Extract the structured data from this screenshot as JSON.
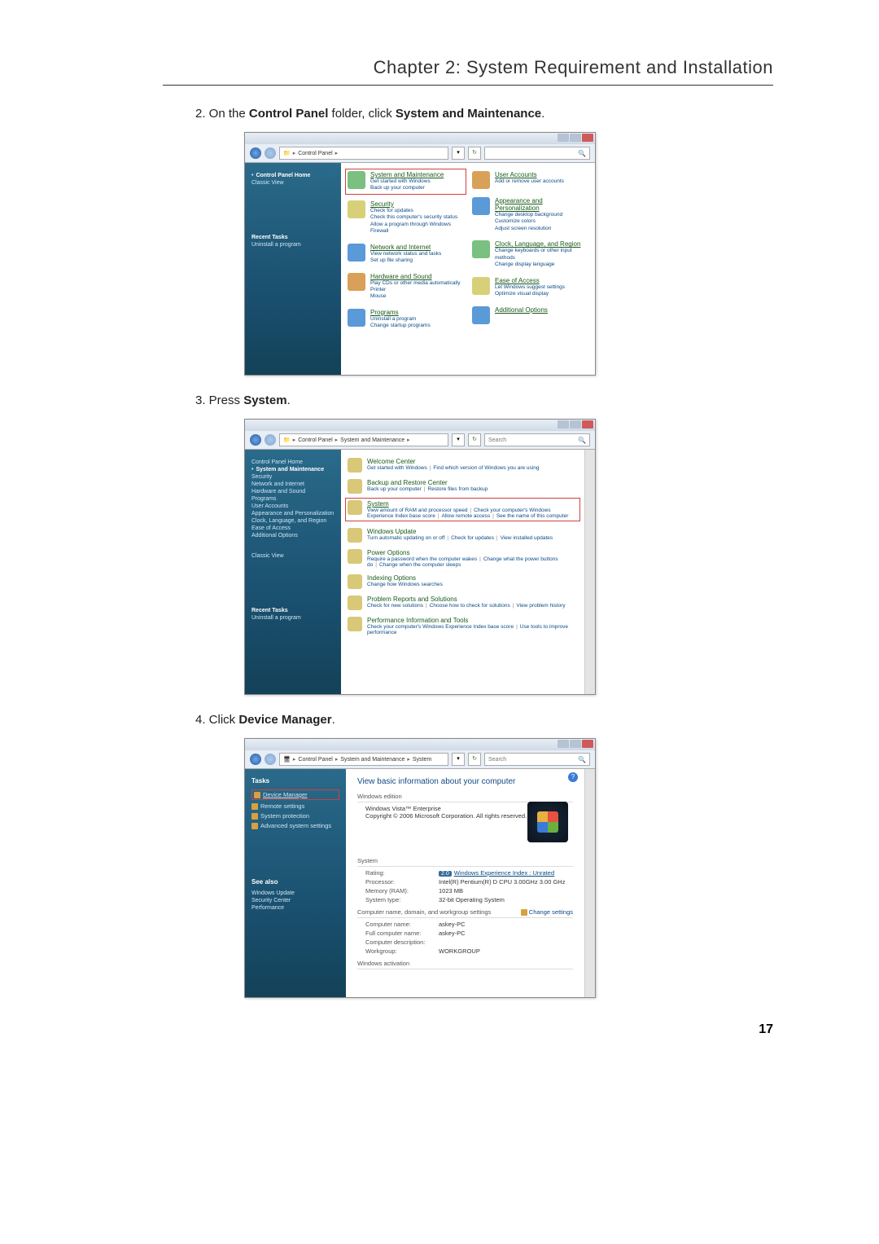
{
  "header": {
    "chapter_title": "Chapter 2: System Requirement and Installation"
  },
  "steps": {
    "s2_prefix": "2.  On the ",
    "s2_bold1": "Control Panel",
    "s2_mid": " folder, click ",
    "s2_bold2": "System and Maintenance",
    "s2_suffix": ".",
    "s3_prefix": "3.  Press ",
    "s3_bold": "System",
    "s3_suffix": ".",
    "s4_prefix": "4.  Click ",
    "s4_bold": "Device Manager",
    "s4_suffix": "."
  },
  "shot1": {
    "breadcrumb": [
      "Control Panel"
    ],
    "search_placeholder": "",
    "sidebar": {
      "home": "Control Panel Home",
      "classic": "Classic View",
      "recent_hdr": "Recent Tasks",
      "recent_item": "Uninstall a program"
    },
    "left_col": [
      {
        "title": "System and Maintenance",
        "subs": [
          "Get started with Windows",
          "Back up your computer"
        ],
        "boxed": true
      },
      {
        "title": "Security",
        "subs": [
          "Check for updates",
          "Check this computer's security status",
          "Allow a program through Windows Firewall"
        ]
      },
      {
        "title": "Network and Internet",
        "subs": [
          "View network status and tasks",
          "Set up file sharing"
        ]
      },
      {
        "title": "Hardware and Sound",
        "subs": [
          "Play CDs or other media automatically",
          "Printer",
          "Mouse"
        ]
      },
      {
        "title": "Programs",
        "subs": [
          "Uninstall a program",
          "Change startup programs"
        ]
      }
    ],
    "right_col": [
      {
        "title": "User Accounts",
        "subs": [
          "Add or remove user accounts"
        ]
      },
      {
        "title": "Appearance and Personalization",
        "subs": [
          "Change desktop background",
          "Customize colors",
          "Adjust screen resolution"
        ]
      },
      {
        "title": "Clock, Language, and Region",
        "subs": [
          "Change keyboards or other input methods",
          "Change display language"
        ]
      },
      {
        "title": "Ease of Access",
        "subs": [
          "Let Windows suggest settings",
          "Optimize visual display"
        ]
      },
      {
        "title": "Additional Options",
        "subs": []
      }
    ]
  },
  "shot2": {
    "breadcrumb": [
      "Control Panel",
      "System and Maintenance"
    ],
    "search_placeholder": "Search",
    "sidebar_items": [
      "Control Panel Home",
      "System and Maintenance",
      "Security",
      "Network and Internet",
      "Hardware and Sound",
      "Programs",
      "User Accounts",
      "Appearance and Personalization",
      "Clock, Language, and Region",
      "Ease of Access",
      "Additional Options"
    ],
    "sidebar_classic": "Classic View",
    "recent_hdr": "Recent Tasks",
    "recent_item": "Uninstall a program",
    "items": [
      {
        "title": "Welcome Center",
        "subs": [
          "Get started with Windows",
          "Find which version of Windows you are using"
        ]
      },
      {
        "title": "Backup and Restore Center",
        "subs": [
          "Back up your computer",
          "Restore files from backup"
        ]
      },
      {
        "title": "System",
        "subs": [
          "View amount of RAM and processor speed",
          "Check your computer's Windows Experience Index base score",
          "Allow remote access",
          "See the name of this computer"
        ],
        "boxed": true
      },
      {
        "title": "Windows Update",
        "subs": [
          "Turn automatic updating on or off",
          "Check for updates",
          "View installed updates"
        ]
      },
      {
        "title": "Power Options",
        "subs": [
          "Require a password when the computer wakes",
          "Change what the power buttons do",
          "Change when the computer sleeps"
        ]
      },
      {
        "title": "Indexing Options",
        "subs": [
          "Change how Windows searches"
        ]
      },
      {
        "title": "Problem Reports and Solutions",
        "subs": [
          "Check for new solutions",
          "Choose how to check for solutions",
          "View problem history"
        ]
      },
      {
        "title": "Performance Information and Tools",
        "subs": [
          "Check your computer's Windows Experience Index base score",
          "Use tools to improve performance"
        ]
      }
    ]
  },
  "shot3": {
    "breadcrumb": [
      "Control Panel",
      "System and Maintenance",
      "System"
    ],
    "search_placeholder": "Search",
    "tasks_hdr": "Tasks",
    "tasks": [
      {
        "label": "Device Manager",
        "boxed": true
      },
      {
        "label": "Remote settings"
      },
      {
        "label": "System protection"
      },
      {
        "label": "Advanced system settings"
      }
    ],
    "seealso_hdr": "See also",
    "seealso": [
      "Windows Update",
      "Security Center",
      "Performance"
    ],
    "main_hdr": "View basic information about your computer",
    "edition_hdr": "Windows edition",
    "edition": "Windows Vista™ Enterprise",
    "copyright": "Copyright © 2006 Microsoft Corporation. All rights reserved.",
    "system_hdr": "System",
    "rating_label": "Rating:",
    "rating_val": "2.0",
    "rating_link": "Windows Experience Index : Unrated",
    "proc_label": "Processor:",
    "proc_val": "Intel(R) Pentium(R) D CPU 3.00GHz  3.00 GHz",
    "ram_label": "Memory (RAM):",
    "ram_val": "1023 MB",
    "type_label": "System type:",
    "type_val": "32-bit Operating System",
    "comp_hdr": "Computer name, domain, and workgroup settings",
    "change": "Change settings",
    "cname_label": "Computer name:",
    "cname_val": "askey-PC",
    "fcname_label": "Full computer name:",
    "fcname_val": "askey-PC",
    "cdesc_label": "Computer description:",
    "cdesc_val": "",
    "wg_label": "Workgroup:",
    "wg_val": "WORKGROUP",
    "act_hdr": "Windows activation"
  },
  "page_number": "17"
}
